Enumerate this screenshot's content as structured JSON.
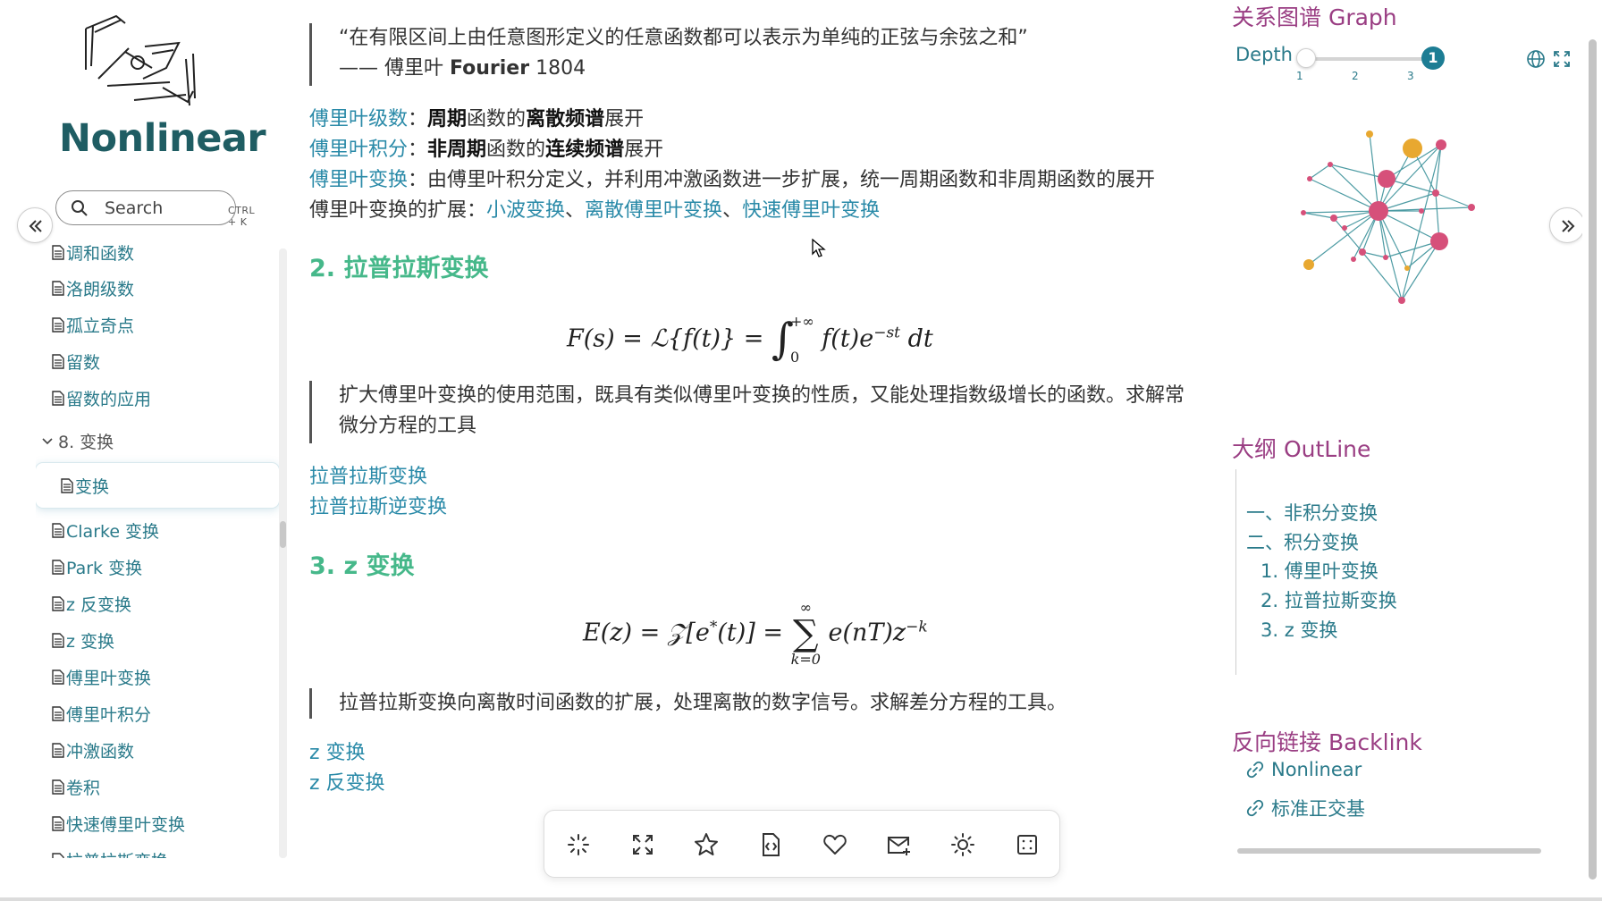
{
  "sidebar": {
    "site_title": "Nonlinear",
    "search": {
      "label": "Search",
      "shortcut": "CTRL + K"
    },
    "items": [
      {
        "label": "调和函数"
      },
      {
        "label": "洛朗级数"
      },
      {
        "label": "孤立奇点"
      },
      {
        "label": "留数"
      },
      {
        "label": "留数的应用"
      }
    ],
    "section": "8. 变换",
    "active_item": "变换",
    "items2": [
      {
        "label": "Clarke 变换"
      },
      {
        "label": "Park 变换"
      },
      {
        "label": "z 反变换"
      },
      {
        "label": "z 变换"
      },
      {
        "label": "傅里叶变换"
      },
      {
        "label": "傅里叶积分"
      },
      {
        "label": "冲激函数"
      },
      {
        "label": "卷积"
      },
      {
        "label": "快速傅里叶变换"
      },
      {
        "label": "拉普拉斯变换"
      }
    ]
  },
  "main": {
    "quote": {
      "text": "“在有限区间上由任意图形定义的任意函数都可以表示为单纯的正弦与余弦之和”",
      "author_prefix": "—— 傅里叶 ",
      "author_bold": "Fourier",
      "year": " 1804"
    },
    "fourier_series": {
      "link": "傅里叶级数",
      "colon": "：",
      "b1": "周期",
      "t1": "函数的",
      "b2": "离散频谱",
      "t2": "展开"
    },
    "fourier_integral": {
      "link": "傅里叶积分",
      "colon": "：",
      "b1": "非周期",
      "t1": "函数的",
      "b2": "连续频谱",
      "t2": "展开"
    },
    "fourier_transform": {
      "link": "傅里叶变换",
      "text": "：由傅里叶积分定义，并利用冲激函数进一步扩展，统一周期函数和非周期函数的展开"
    },
    "extensions": {
      "text": "傅里叶变换的扩展：",
      "link1": "小波变换",
      "sep1": "、",
      "link2": "离散傅里叶变换",
      "sep2": "、",
      "link3": "快速傅里叶变换"
    },
    "h_laplace": "2. 拉普拉斯变换",
    "laplace_quote": "扩大傅里叶变换的使用范围，既具有类似傅里叶变换的性质，又能处理指数级增长的函数。求解常微分方程的工具",
    "laplace_links": [
      "拉普拉斯变换",
      "拉普拉斯逆变换"
    ],
    "h_z": "3. z 变换",
    "z_quote": "拉普拉斯变换向离散时间函数的扩展，处理离散的数字信号。求解差分方程的工具。",
    "z_links": [
      "z 变换",
      "z 反变换"
    ]
  },
  "right": {
    "graph_title": "关系图谱 Graph",
    "depth_label": "Depth",
    "depth_ticks": [
      "1",
      "2",
      "3"
    ],
    "depth_value": "1",
    "outline_title": "大纲 OutLine",
    "outline": [
      "一、非积分变换",
      "二、积分变换",
      "1. 傅里叶变换",
      "2. 拉普拉斯变换",
      "3. z 变换"
    ],
    "backlink_title": "反向链接 Backlink",
    "backlinks": [
      "Nonlinear",
      "标准正交基"
    ]
  },
  "colors": {
    "accent_teal": "#2a8aa8",
    "heading_green": "#46b88a",
    "panel_purple": "#9a3e83",
    "graph_pink": "#d6507a",
    "graph_gold": "#e8a830"
  }
}
